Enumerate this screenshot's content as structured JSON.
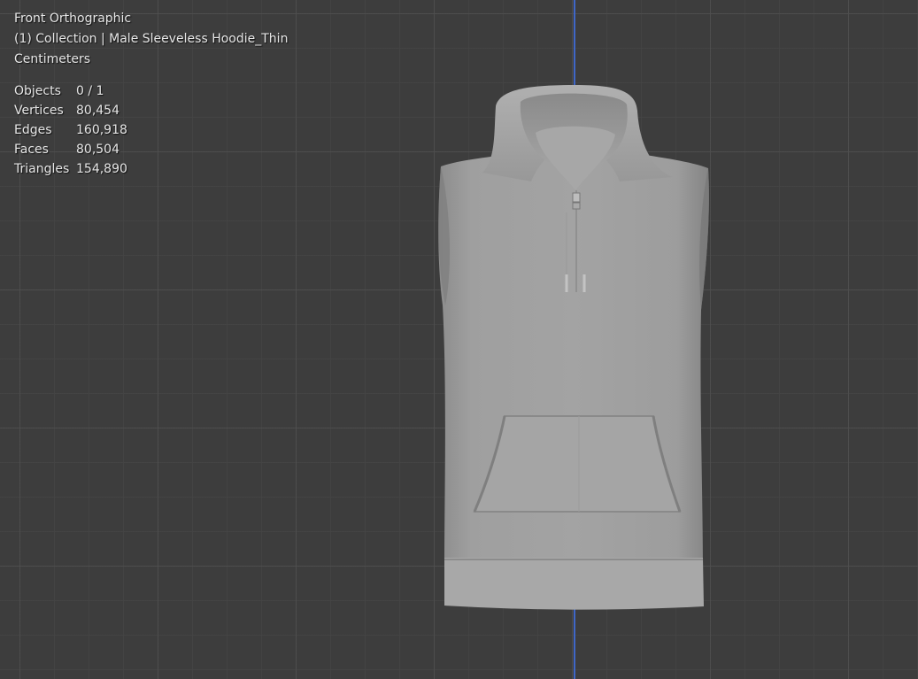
{
  "viewport": {
    "view_name": "Front Orthographic",
    "collection_label": "(1) Collection | Male Sleeveless Hoodie_Thin",
    "units": "Centimeters",
    "axis_color": "#3f67c8",
    "background_color": "#3d3d3d"
  },
  "stats": [
    {
      "label": "Objects",
      "value": "0 / 1"
    },
    {
      "label": "Vertices",
      "value": "80,454"
    },
    {
      "label": "Edges",
      "value": "160,918"
    },
    {
      "label": "Faces",
      "value": "80,504"
    },
    {
      "label": "Triangles",
      "value": "154,890"
    }
  ]
}
